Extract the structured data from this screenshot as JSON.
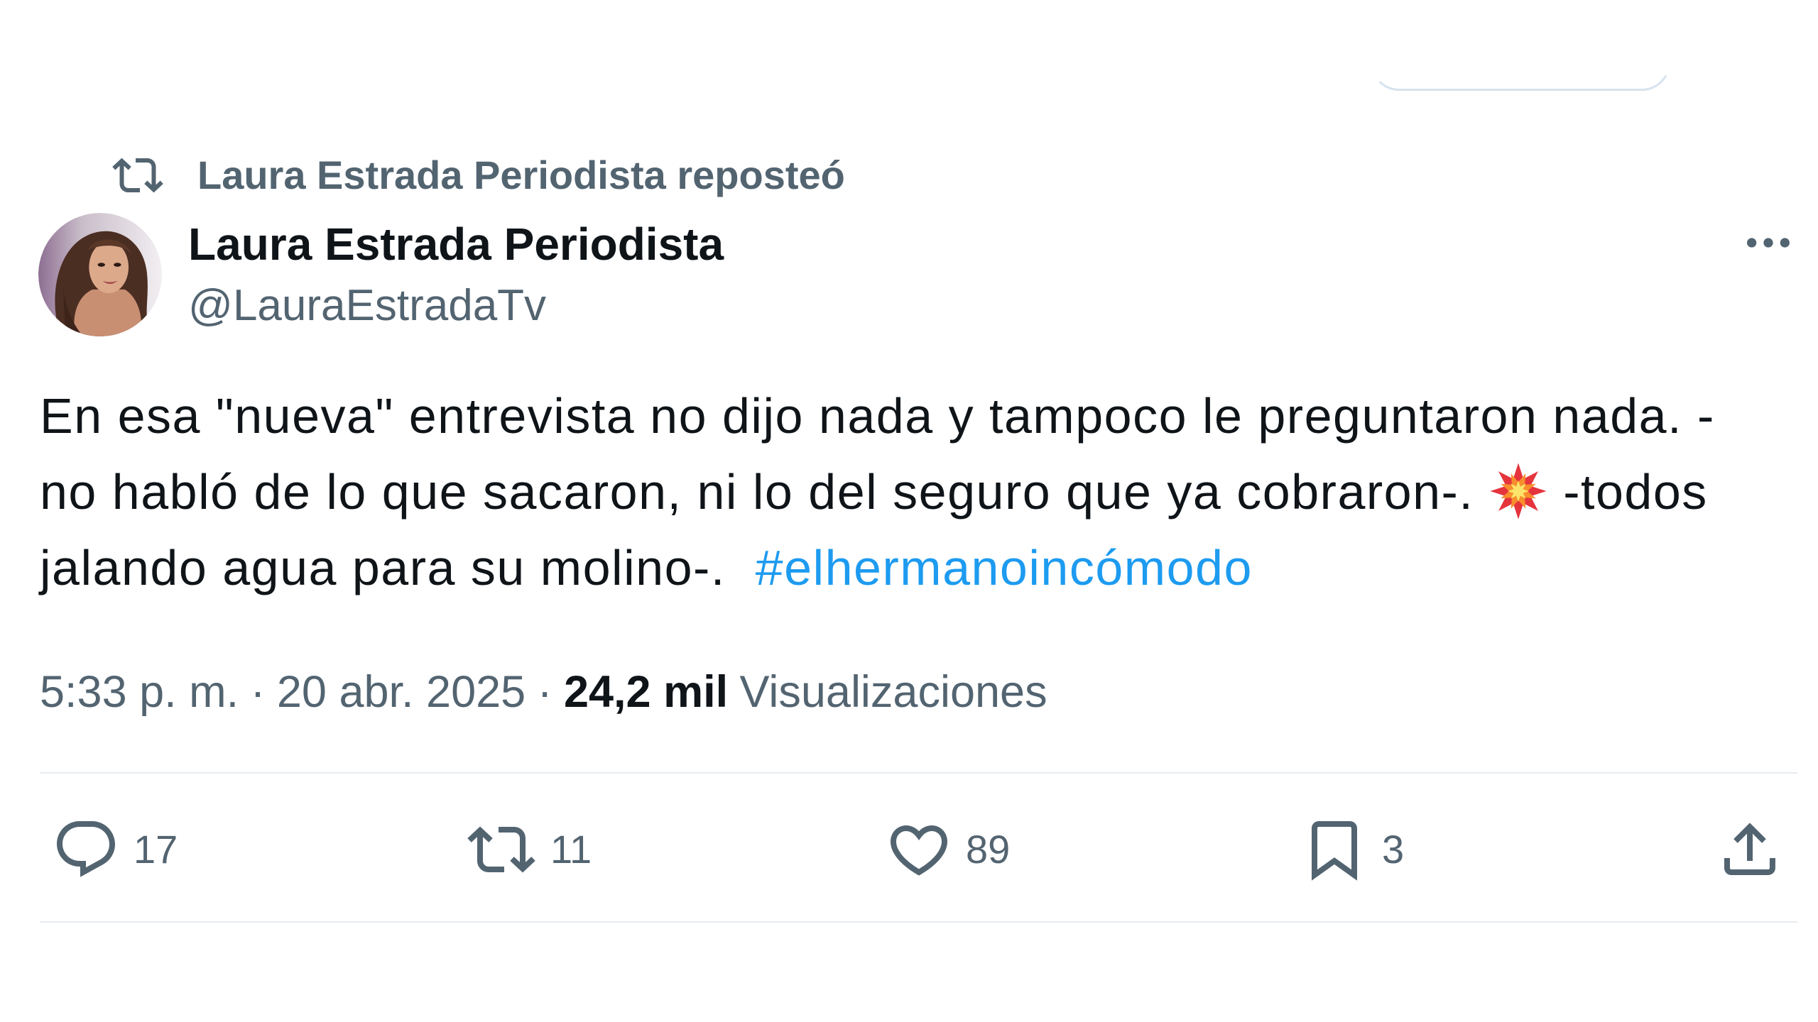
{
  "social_context": {
    "icon": "repost-icon",
    "label": "Laura Estrada Periodista reposteó"
  },
  "author": {
    "avatar": "avatar-photo",
    "name": "Laura Estrada Periodista",
    "handle": "@LauraEstradaTv"
  },
  "more_menu": {
    "icon": "more-dots-icon"
  },
  "tweet": {
    "line1": "En esa \"nueva\" entrevista no dijo nada y tampoco le preguntaron nada. -",
    "line2_before_emoji": "no habló de lo que sacaron, ni lo del seguro que ya cobraron-. ",
    "emoji": "collision-emoji",
    "line2_after_emoji": " -todos",
    "line3_before_hashtag": "jalando agua para su molino-.  ",
    "hashtag": "#elhermanoincómodo"
  },
  "meta": {
    "time": "5:33 p. m.",
    "separator": "·",
    "date": "20 abr. 2025",
    "views_count": "24,2 mil",
    "views_label": "Visualizaciones"
  },
  "actions": {
    "reply": {
      "icon": "reply-icon",
      "count": "17"
    },
    "repost": {
      "icon": "repost-icon",
      "count": "11"
    },
    "like": {
      "icon": "heart-icon",
      "count": "89"
    },
    "bookmark": {
      "icon": "bookmark-icon",
      "count": "3"
    },
    "share": {
      "icon": "share-icon"
    }
  },
  "colors": {
    "text_primary": "#0f1419",
    "text_secondary": "#536471",
    "link": "#1d9bf0",
    "divider": "#eff3f4",
    "background": "#ffffff"
  }
}
